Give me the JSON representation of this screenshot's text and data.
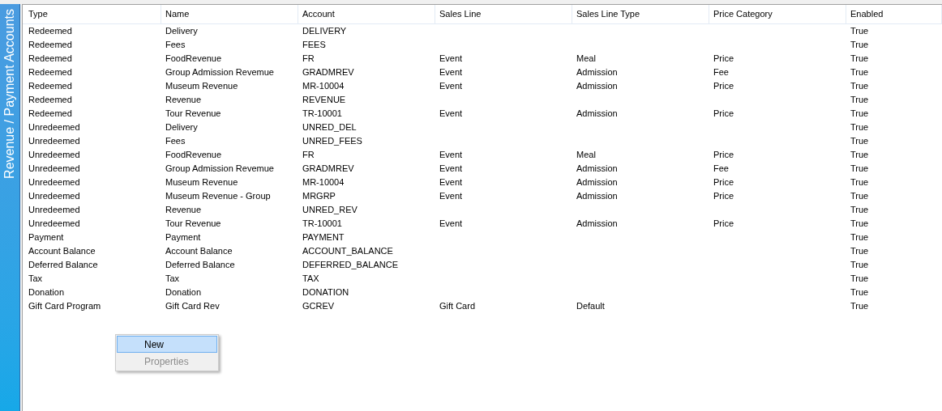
{
  "side_tab": {
    "label": "Revenue / Payment Accounts"
  },
  "table": {
    "columns": [
      "Type",
      "Name",
      "Account",
      "Sales Line",
      "Sales Line Type",
      "Price Category",
      "Enabled"
    ],
    "rows": [
      {
        "type": "Redeemed",
        "name": "Delivery",
        "account": "DELIVERY",
        "enabled": "True"
      },
      {
        "type": "Redeemed",
        "name": "Fees",
        "account": "FEES",
        "enabled": "True"
      },
      {
        "type": "Redeemed",
        "name": "FoodRevenue",
        "account": "FR",
        "sales_line": "Event",
        "sales_line_type": "Meal",
        "price_category": "Price",
        "enabled": "True"
      },
      {
        "type": "Redeemed",
        "name": "Group Admission Revemue",
        "account": "GRADMREV",
        "sales_line": "Event",
        "sales_line_type": "Admission",
        "price_category": "Fee",
        "enabled": "True"
      },
      {
        "type": "Redeemed",
        "name": "Museum Revenue",
        "account": "MR-10004",
        "sales_line": "Event",
        "sales_line_type": "Admission",
        "price_category": "Price",
        "enabled": "True"
      },
      {
        "type": "Redeemed",
        "name": "Revenue",
        "account": "REVENUE",
        "enabled": "True"
      },
      {
        "type": "Redeemed",
        "name": "Tour Revenue",
        "account": "TR-10001",
        "sales_line": "Event",
        "sales_line_type": "Admission",
        "price_category": "Price",
        "enabled": "True"
      },
      {
        "type": "Unredeemed",
        "name": "Delivery",
        "account": "UNRED_DEL",
        "enabled": "True"
      },
      {
        "type": "Unredeemed",
        "name": "Fees",
        "account": "UNRED_FEES",
        "enabled": "True"
      },
      {
        "type": "Unredeemed",
        "name": "FoodRevenue",
        "account": "FR",
        "sales_line": "Event",
        "sales_line_type": "Meal",
        "price_category": "Price",
        "enabled": "True"
      },
      {
        "type": "Unredeemed",
        "name": "Group Admission Revemue",
        "account": "GRADMREV",
        "sales_line": "Event",
        "sales_line_type": "Admission",
        "price_category": "Fee",
        "enabled": "True"
      },
      {
        "type": "Unredeemed",
        "name": "Museum Revenue",
        "account": "MR-10004",
        "sales_line": "Event",
        "sales_line_type": "Admission",
        "price_category": "Price",
        "enabled": "True"
      },
      {
        "type": "Unredeemed",
        "name": "Museum Revenue - Group",
        "account": "MRGRP",
        "sales_line": "Event",
        "sales_line_type": "Admission",
        "price_category": "Price",
        "enabled": "True"
      },
      {
        "type": "Unredeemed",
        "name": "Revenue",
        "account": "UNRED_REV",
        "enabled": "True"
      },
      {
        "type": "Unredeemed",
        "name": "Tour Revenue",
        "account": "TR-10001",
        "sales_line": "Event",
        "sales_line_type": "Admission",
        "price_category": "Price",
        "enabled": "True"
      },
      {
        "type": "Payment",
        "name": "Payment",
        "account": "PAYMENT",
        "enabled": "True"
      },
      {
        "type": "Account Balance",
        "name": "Account Balance",
        "account": "ACCOUNT_BALANCE",
        "enabled": "True"
      },
      {
        "type": "Deferred Balance",
        "name": "Deferred Balance",
        "account": "DEFERRED_BALANCE",
        "enabled": "True"
      },
      {
        "type": "Tax",
        "name": "Tax",
        "account": "TAX",
        "enabled": "True"
      },
      {
        "type": "Donation",
        "name": "Donation",
        "account": "DONATION",
        "enabled": "True"
      },
      {
        "type": "Gift Card Program",
        "name": "Gift Card Rev",
        "account": "GCREV",
        "sales_line": "Gift Card",
        "sales_line_type": "Default",
        "enabled": "True"
      }
    ]
  },
  "context_menu": {
    "items": [
      {
        "label": "New",
        "selected": true,
        "disabled": false
      },
      {
        "label": "Properties",
        "selected": false,
        "disabled": true
      }
    ]
  }
}
